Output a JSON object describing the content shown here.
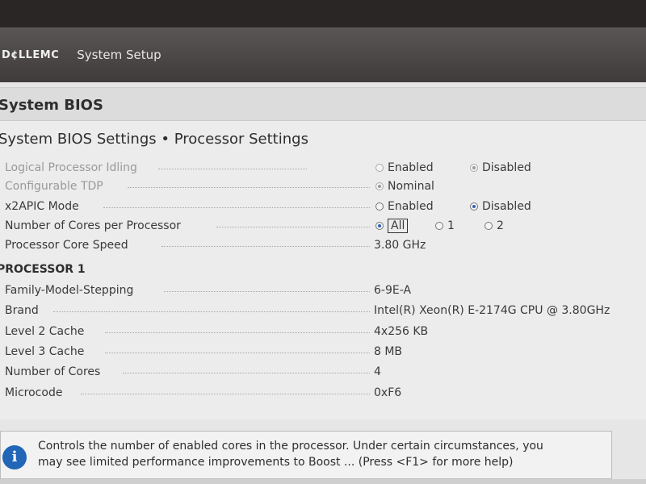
{
  "header": {
    "brand": "D¢LLEMC",
    "app_title": "System Setup"
  },
  "page_title": "System BIOS",
  "breadcrumb": "System BIOS Settings • Processor Settings",
  "settings": [
    {
      "label": "Logical Processor Idling",
      "options": [
        "Enabled",
        "Disabled"
      ],
      "selected": "Disabled",
      "disabled": true
    },
    {
      "label": "Configurable TDP",
      "options": [
        "Nominal"
      ],
      "selected": "Nominal",
      "disabled": true
    },
    {
      "label": "x2APIC Mode",
      "options": [
        "Enabled",
        "Disabled"
      ],
      "selected": "Disabled",
      "disabled": false
    },
    {
      "label": "Number of Cores per Processor",
      "options": [
        "All",
        "1",
        "2"
      ],
      "selected": "All",
      "disabled": false
    },
    {
      "label": "Processor Core Speed",
      "value": "3.80 GHz"
    }
  ],
  "processor_group": {
    "title": "PROCESSOR 1",
    "rows": [
      {
        "label": "Family-Model-Stepping",
        "value": "6-9E-A"
      },
      {
        "label": "Brand",
        "value": "Intel(R) Xeon(R) E-2174G CPU @ 3.80GHz"
      },
      {
        "label": "Level 2 Cache",
        "value": "4x256 KB"
      },
      {
        "label": "Level 3 Cache",
        "value": "8 MB"
      },
      {
        "label": "Number of Cores",
        "value": "4"
      },
      {
        "label": "Microcode",
        "value": "0xF6"
      }
    ]
  },
  "help": {
    "icon": "info-icon",
    "line1": "Controls the number of enabled cores in the processor. Under certain circumstances, you",
    "line2": "may see limited performance improvements to Boost ... (Press <F1> for more help)"
  },
  "colors": {
    "accent": "#2266b7",
    "header_bg": "#3f3b3b"
  }
}
